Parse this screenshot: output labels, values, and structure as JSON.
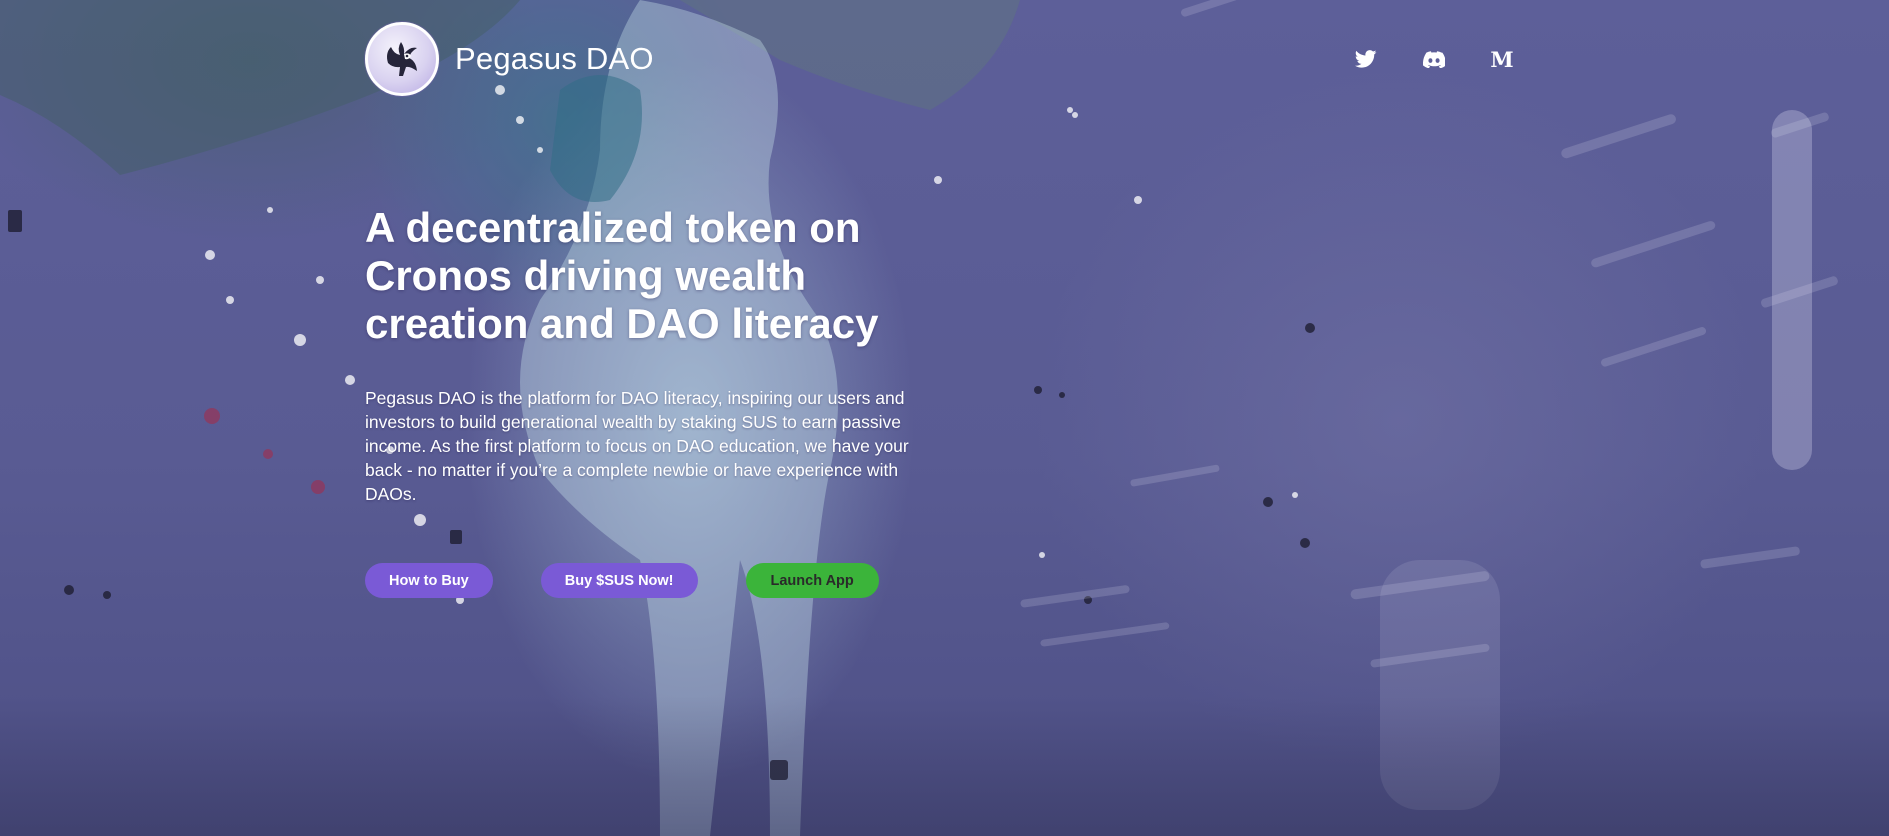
{
  "brand": {
    "name": "Pegasus DAO",
    "logo_icon": "pegasus-logo-icon"
  },
  "socials": [
    {
      "name": "twitter",
      "icon": "twitter-icon"
    },
    {
      "name": "discord",
      "icon": "discord-icon"
    },
    {
      "name": "medium",
      "icon": "medium-icon",
      "glyph": "M"
    }
  ],
  "hero": {
    "headline": "A decentralized token on Cronos driving wealth creation and DAO literacy",
    "description": "Pegasus DAO is the platform for DAO literacy, inspiring our users and investors to build generational wealth by staking SUS to earn passive income. As the first platform to focus on DAO education, we have your back - no matter if you’re a complete newbie or have experience with DAOs."
  },
  "buttons": {
    "how_to_buy": "How to Buy",
    "buy_sus": "Buy $SUS Now!",
    "launch_app": "Launch App"
  },
  "colors": {
    "button_purple": "#7a5ad6",
    "button_green": "#3bb43a",
    "background": "#5b5c94"
  }
}
